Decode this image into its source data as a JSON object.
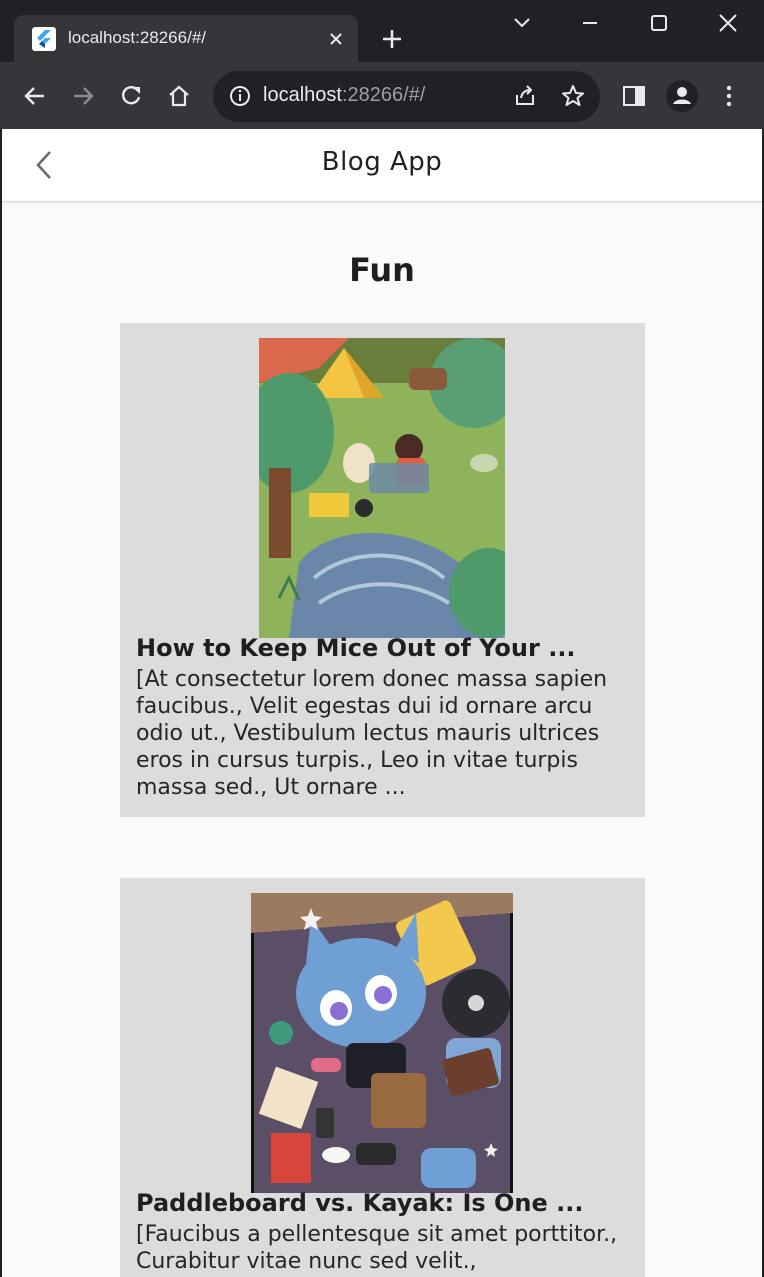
{
  "browser": {
    "tab_title": "localhost:28266/#/",
    "url_host": "localhost",
    "url_rest": ":28266/#/"
  },
  "appbar": {
    "title": "Blog App"
  },
  "section": {
    "title": "Fun"
  },
  "posts": [
    {
      "title": "How to Keep Mice Out of Your ...",
      "body": "[At consectetur lorem donec massa sapien faucibus., Velit egestas dui id ornare arcu odio ut., Vestibulum lectus mauris ultrices eros in cursus turpis., Leo in vitae turpis massa sed., Ut ornare ..."
    },
    {
      "title": "Paddleboard vs. Kayak: Is One ...",
      "body": "[Faucibus a pellentesque sit amet porttitor., Curabitur vitae nunc sed velit.,"
    }
  ],
  "colors": {
    "card_bg": "#dcdcdc",
    "page_bg": "#fafafa",
    "chrome_dark": "#202124",
    "chrome_toolbar": "#35363a"
  }
}
